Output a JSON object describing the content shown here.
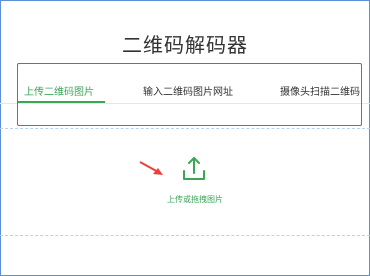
{
  "page": {
    "title": "二维码解码器"
  },
  "tabs": [
    {
      "label": "上传二维码图片",
      "active": true
    },
    {
      "label": "输入二维码图片网址",
      "active": false
    },
    {
      "label": "摄像头扫描二维码",
      "active": false
    }
  ],
  "upload": {
    "label": "上传或拖拽图片",
    "icon": "upload-icon"
  },
  "annotations": {
    "tabs_highlight": "red-rectangle",
    "pointer": "red-arrow-icon"
  },
  "colors": {
    "accent": "#3aa757",
    "annotation": "#e8413c",
    "text": "#333333"
  }
}
